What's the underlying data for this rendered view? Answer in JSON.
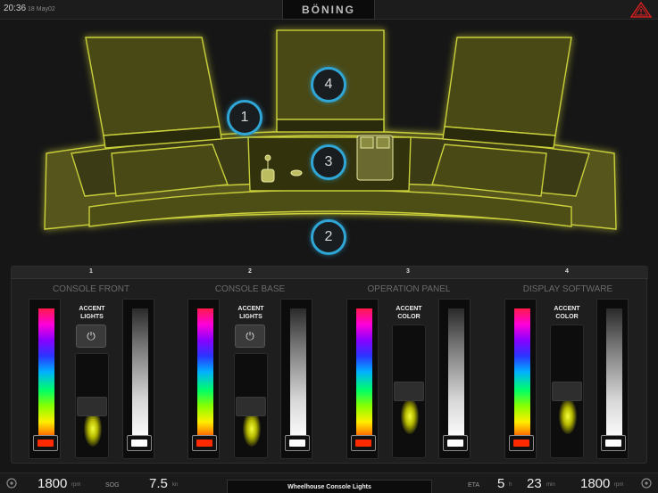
{
  "topbar": {
    "time": "20:36",
    "date": "18 May02",
    "brand": "BÖNING"
  },
  "console": {
    "badges": [
      "1",
      "2",
      "3",
      "4"
    ]
  },
  "panel": {
    "sections": [
      {
        "number": "1",
        "title": "CONSOLE FRONT",
        "accent_label": "ACCENT\nLIGHTS",
        "has_power": true
      },
      {
        "number": "2",
        "title": "CONSOLE BASE",
        "accent_label": "ACCENT\nLIGHTS",
        "has_power": true
      },
      {
        "number": "3",
        "title": "OPERATION PANEL",
        "accent_label": "ACCENT\nCOLOR",
        "has_power": false
      },
      {
        "number": "4",
        "title": "DISPLAY SOFTWARE",
        "accent_label": "ACCENT\nCOLOR",
        "has_power": false
      }
    ],
    "power_symbol": "⏻"
  },
  "bottombar": {
    "rpm_left_value": "1800",
    "rpm_left_unit": "rpm",
    "sog_label": "SOG",
    "sog_value": "7.5",
    "sog_unit": "kn",
    "title": "Wheelhouse Console Lights",
    "eta_label": "ETA",
    "eta_hours": "5",
    "eta_hours_unit": "h",
    "eta_minutes": "23",
    "eta_minutes_unit": "min",
    "rpm_right_value": "1800",
    "rpm_right_unit": "rpm"
  },
  "colors": {
    "accent_glow": "#d8e84a",
    "badge_ring": "#2fa6d6",
    "warning": "#d32020"
  },
  "icons": [
    "warning-icon",
    "power-icon",
    "engine-left-icon",
    "engine-right-icon"
  ]
}
